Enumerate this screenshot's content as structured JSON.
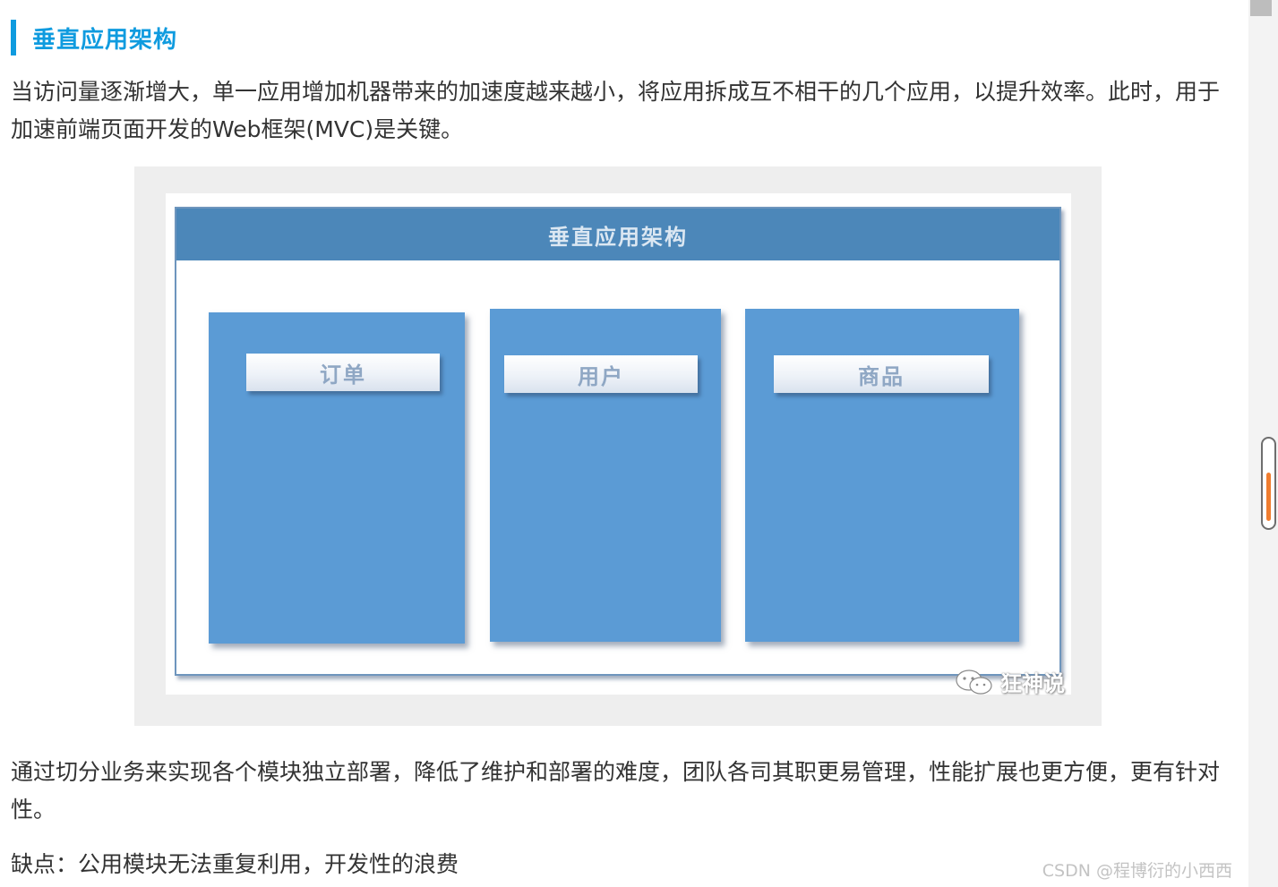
{
  "section": {
    "heading": "垂直应用架构"
  },
  "paragraphs": {
    "intro": "当访问量逐渐增大，单一应用增加机器带来的加速度越来越小，将应用拆成互不相干的几个应用，以提升效率。此时，用于加速前端页面开发的Web框架(MVC)是关键。",
    "benefit": "通过切分业务来实现各个模块独立部署，降低了维护和部署的难度，团队各司其职更易管理，性能扩展也更方便，更有针对性。",
    "drawback": "缺点：公用模块无法重复利用，开发性的浪费"
  },
  "figure": {
    "title": "垂直应用架构",
    "modules": [
      {
        "label": "订单"
      },
      {
        "label": "用户"
      },
      {
        "label": "商品"
      }
    ],
    "watermark": "狂神说"
  },
  "page_watermark": "CSDN @程博衍的小西西",
  "colors": {
    "heading_accent": "#0f9bdf",
    "diagram_header": "#4c87b9",
    "module_fill": "#5b9bd5",
    "scroll_thumb_accent": "#f07c2e"
  },
  "icons": {
    "watermark_logo": "wechat-icon"
  }
}
